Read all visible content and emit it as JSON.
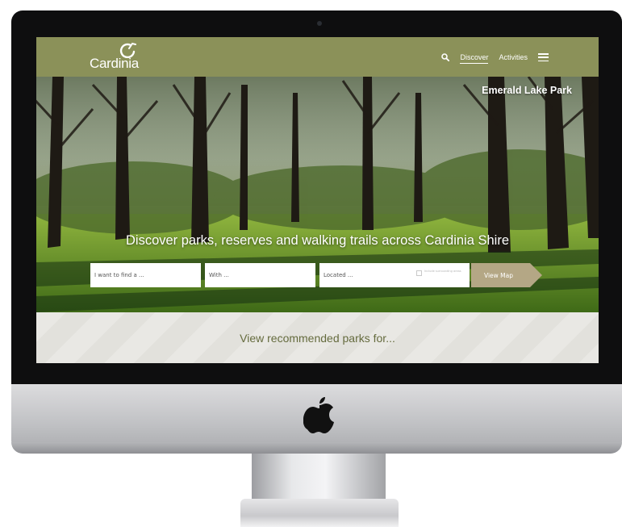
{
  "brand": {
    "name": "Cardinia"
  },
  "nav": {
    "items": [
      {
        "label": "Discover"
      },
      {
        "label": "Activities"
      }
    ]
  },
  "hero": {
    "location": "Emerald Lake Park",
    "headline": "Discover parks, reserves and walking trails across Cardinia Shire"
  },
  "search": {
    "find_placeholder": "I want to find a ...",
    "with_placeholder": "With ...",
    "located_placeholder": "Located ...",
    "include_label": "Include surrounding areas",
    "view_map_label": "View Map"
  },
  "recommend": {
    "title": "View recommended parks for..."
  },
  "colors": {
    "header_green": "#8b9159",
    "button_tan": "#b4a785",
    "recommend_text": "#656b3e"
  }
}
